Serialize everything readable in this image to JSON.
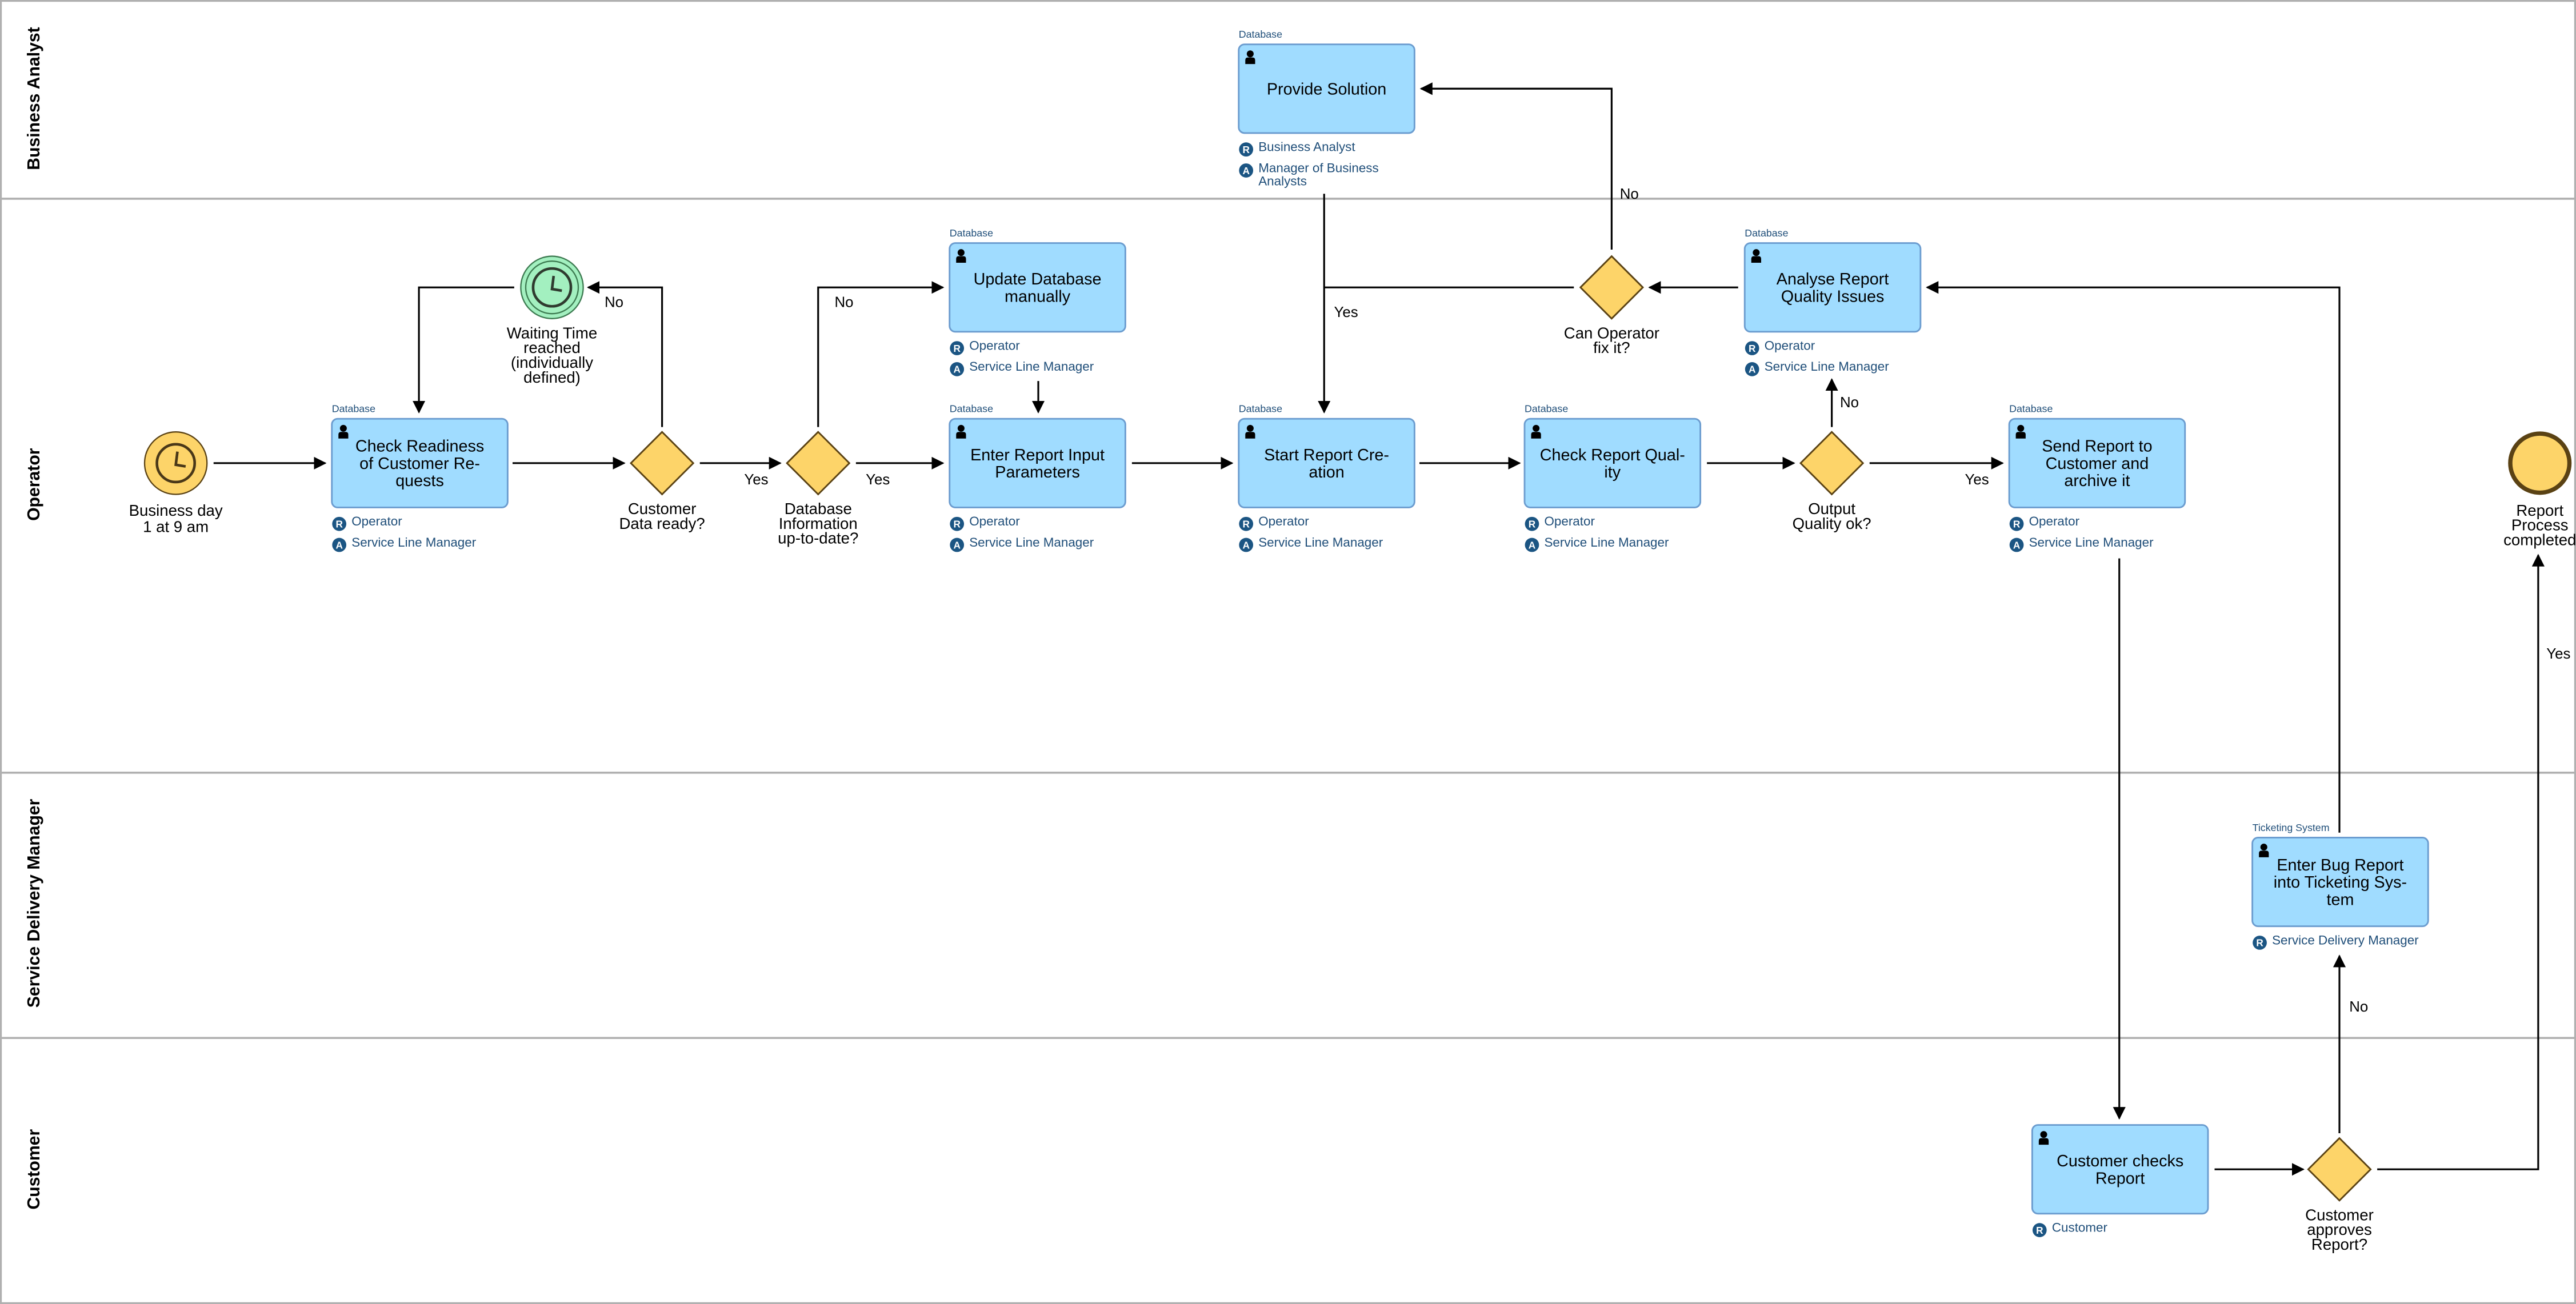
{
  "diagram": {
    "type": "BPMN process diagram",
    "lanes": [
      {
        "id": "business-analyst",
        "label": "Business Analyst"
      },
      {
        "id": "operator",
        "label": "Operator"
      },
      {
        "id": "service-delivery-manager",
        "label": "Service Delivery Manager"
      },
      {
        "id": "customer",
        "label": "Customer"
      }
    ],
    "events": {
      "start": {
        "label_1": "Business day",
        "label_2": "1 at 9 am",
        "kind": "timer-start"
      },
      "waiting": {
        "label_1": "Waiting Time",
        "label_2": "reached",
        "label_3": "(individually",
        "label_4": "defined)",
        "kind": "timer-intermediate"
      },
      "end": {
        "label_1": "Report",
        "label_2": "Process",
        "label_3": "completed",
        "kind": "end"
      }
    },
    "tasks": {
      "provide_solution": {
        "system": "Database",
        "lines": [
          "Provide Solution"
        ],
        "roles": [
          {
            "type": "R",
            "name": "Business Analyst"
          },
          {
            "type": "A",
            "name": "Manager of Business",
            "name2": "Analysts"
          }
        ]
      },
      "check_readiness": {
        "system": "Database",
        "lines": [
          "Check Readiness",
          "of Customer Re-",
          "quests"
        ],
        "roles": [
          {
            "type": "R",
            "name": "Operator"
          },
          {
            "type": "A",
            "name": "Service Line Manager"
          }
        ]
      },
      "update_database": {
        "system": "Database",
        "lines": [
          "Update Database",
          "manually"
        ],
        "roles": [
          {
            "type": "R",
            "name": "Operator"
          },
          {
            "type": "A",
            "name": "Service Line Manager"
          }
        ]
      },
      "enter_report_params": {
        "system": "Database",
        "lines": [
          "Enter Report Input",
          "Parameters"
        ],
        "roles": [
          {
            "type": "R",
            "name": "Operator"
          },
          {
            "type": "A",
            "name": "Service Line Manager"
          }
        ]
      },
      "start_report": {
        "system": "Database",
        "lines": [
          "Start Report Cre-",
          "ation"
        ],
        "roles": [
          {
            "type": "R",
            "name": "Operator"
          },
          {
            "type": "A",
            "name": "Service Line Manager"
          }
        ]
      },
      "check_quality": {
        "system": "Database",
        "lines": [
          "Check Report Qual-",
          "ity"
        ],
        "roles": [
          {
            "type": "R",
            "name": "Operator"
          },
          {
            "type": "A",
            "name": "Service Line Manager"
          }
        ]
      },
      "analyse_issues": {
        "system": "Database",
        "lines": [
          "Analyse Report",
          "Quality Issues"
        ],
        "roles": [
          {
            "type": "R",
            "name": "Operator"
          },
          {
            "type": "A",
            "name": "Service Line Manager"
          }
        ]
      },
      "send_report": {
        "system": "Database",
        "lines": [
          "Send Report to",
          "Customer and",
          "archive it"
        ],
        "roles": [
          {
            "type": "R",
            "name": "Operator"
          },
          {
            "type": "A",
            "name": "Service Line Manager"
          }
        ]
      },
      "enter_bug": {
        "system": "Ticketing System",
        "lines": [
          "Enter Bug Report",
          "into Ticketing Sys-",
          "tem"
        ],
        "roles": [
          {
            "type": "R",
            "name": "Service Delivery Manager"
          }
        ]
      },
      "customer_checks": {
        "system": "",
        "lines": [
          "Customer checks",
          "Report"
        ],
        "roles": [
          {
            "type": "R",
            "name": "Customer"
          }
        ]
      }
    },
    "gateways": {
      "customer_data_ready": {
        "lines": [
          "Customer",
          "Data ready?"
        ]
      },
      "db_up_to_date": {
        "lines": [
          "Database",
          "Information",
          "up-to-date?"
        ]
      },
      "can_operator_fix": {
        "lines": [
          "Can Operator",
          "fix it?"
        ]
      },
      "output_quality_ok": {
        "lines": [
          "Output",
          "Quality ok?"
        ]
      },
      "customer_approves": {
        "lines": [
          "Customer",
          "approves",
          "Report?"
        ]
      }
    },
    "flow_labels": {
      "yes": "Yes",
      "no": "No"
    },
    "colors": {
      "task_fill": "#a0dcff",
      "task_stroke": "#6b9ccf",
      "gateway_fill": "#fdd469",
      "start_event_fill": "#fdd469",
      "waiting_event_fill": "#a3f0c0",
      "role_badge": "#1b5583",
      "role_text": "#1f4e79"
    }
  }
}
